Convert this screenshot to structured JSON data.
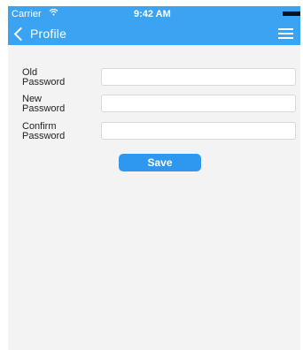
{
  "status_bar": {
    "carrier": "Carrier",
    "time": "9:42 AM"
  },
  "nav": {
    "back_label": "Profile"
  },
  "form": {
    "old_password": {
      "label_line1": "Old",
      "label_line2": "Password",
      "value": ""
    },
    "new_password": {
      "label_line1": "New",
      "label_line2": "Password",
      "value": ""
    },
    "confirm_password": {
      "label_line1": "Confirm",
      "label_line2": "Password",
      "value": ""
    }
  },
  "actions": {
    "save_label": "Save"
  },
  "colors": {
    "accent": "#3aa4f3",
    "button": "#2e97ef",
    "background": "#f3f3f4"
  },
  "icons": {
    "back": "chevron-left-icon",
    "menu": "hamburger-menu-icon",
    "wifi": "wifi-icon",
    "battery": "battery-icon"
  }
}
